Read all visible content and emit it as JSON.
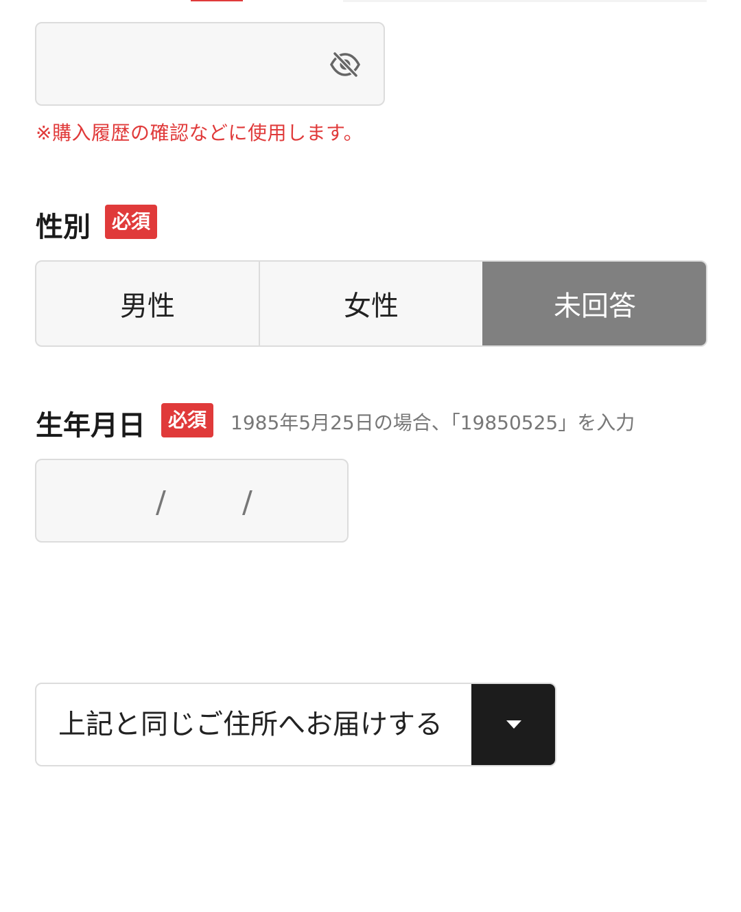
{
  "password": {
    "value": "",
    "visibility_icon": "eye-off-icon",
    "note": "※購入履歴の確認などに使用します。"
  },
  "gender": {
    "label": "性別",
    "required_badge": "必須",
    "options": [
      "男性",
      "女性",
      "未回答"
    ],
    "selected": "未回答"
  },
  "birthdate": {
    "label": "生年月日",
    "required_badge": "必須",
    "hint": "1985年5月25日の場合、「19850525」を入力",
    "separator": "/"
  },
  "address": {
    "selected_label": "上記と同じご住所へお届けする",
    "dropdown_icon": "caret-down-icon"
  },
  "colors": {
    "required": "#e03a3a",
    "selected_segment": "#808080",
    "dropdown_button": "#1c1c1c"
  }
}
